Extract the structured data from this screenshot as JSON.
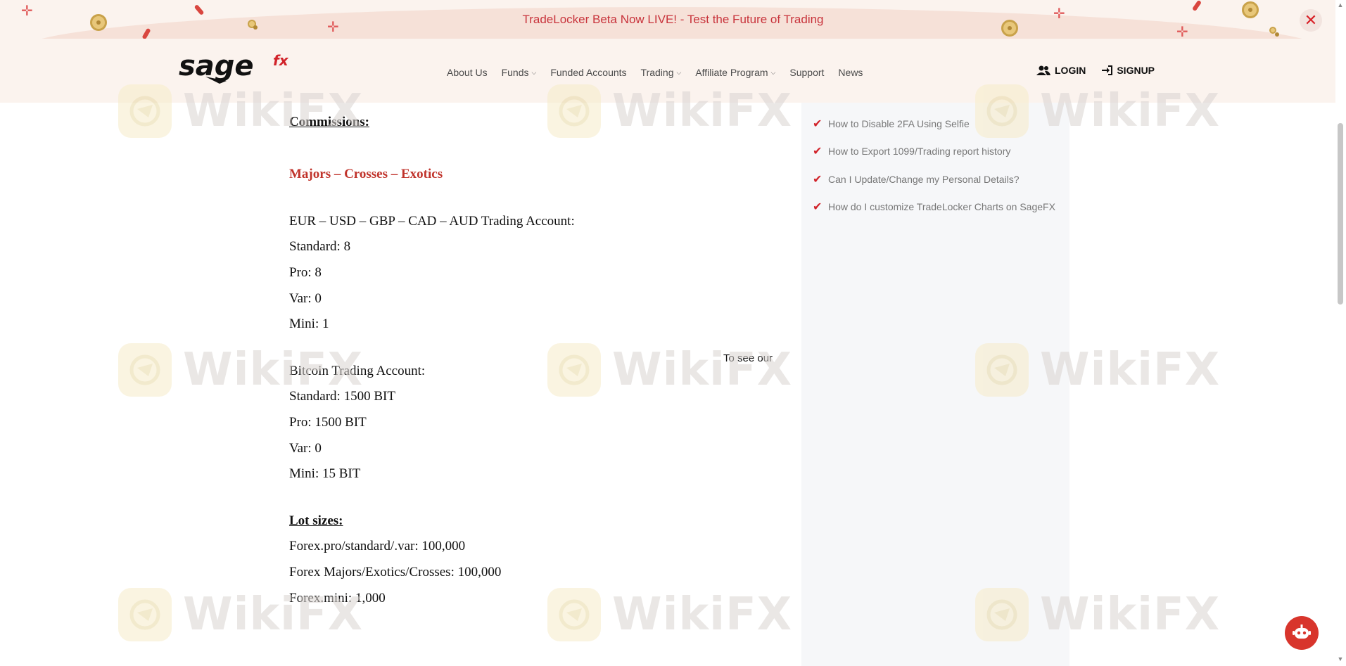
{
  "banner": {
    "text": "TradeLocker Beta Now LIVE! - Test the Future of Trading",
    "close_symbol": "✕"
  },
  "header": {
    "logo_text": "sage",
    "logo_suffix": "fx",
    "nav": [
      {
        "label": "About Us",
        "has_dropdown": false
      },
      {
        "label": "Funds",
        "has_dropdown": true
      },
      {
        "label": "Funded Accounts",
        "has_dropdown": false
      },
      {
        "label": "Trading",
        "has_dropdown": true
      },
      {
        "label": "Affiliate Program",
        "has_dropdown": true
      },
      {
        "label": "Support",
        "has_dropdown": false
      },
      {
        "label": "News",
        "has_dropdown": false
      }
    ],
    "chevron": "⌵",
    "login_label": "LOGIN",
    "signup_label": "SIGNUP"
  },
  "watermark": {
    "text": "WikiFX"
  },
  "content": {
    "commissions_heading": "Commissions:",
    "subheading": "Majors – Crosses – Exotics",
    "currency_account": "EUR – USD – GBP – CAD – AUD Trading Account:",
    "currency_rows": [
      "Standard: 8",
      "Pro: 8",
      "Var: 0",
      "Mini: 1"
    ],
    "bitcoin_account": "Bitcoin Trading Account:",
    "bitcoin_rows": [
      "Standard: 1500 BIT",
      "Pro: 1500  BIT",
      "Var: 0",
      "Mini: 15 BIT"
    ],
    "lot_heading": "Lot sizes:",
    "lot_rows": [
      "Forex.pro/standard/.var: 100,000",
      "Forex Majors/Exotics/Crosses: 100,000",
      "Forex.mini: 1,000"
    ],
    "side_note": "To see our"
  },
  "sidebar": {
    "links": [
      "How to Disable 2FA Using Selfie",
      "How to Export 1099/Trading report history",
      "Can I Update/Change my Personal Details?",
      "How do I customize TradeLocker Charts on SageFX"
    ]
  },
  "colors": {
    "brand_red": "#c8333b",
    "banner_bg": "#fbf3ee",
    "sidebar_bg": "#f6f7f9"
  }
}
